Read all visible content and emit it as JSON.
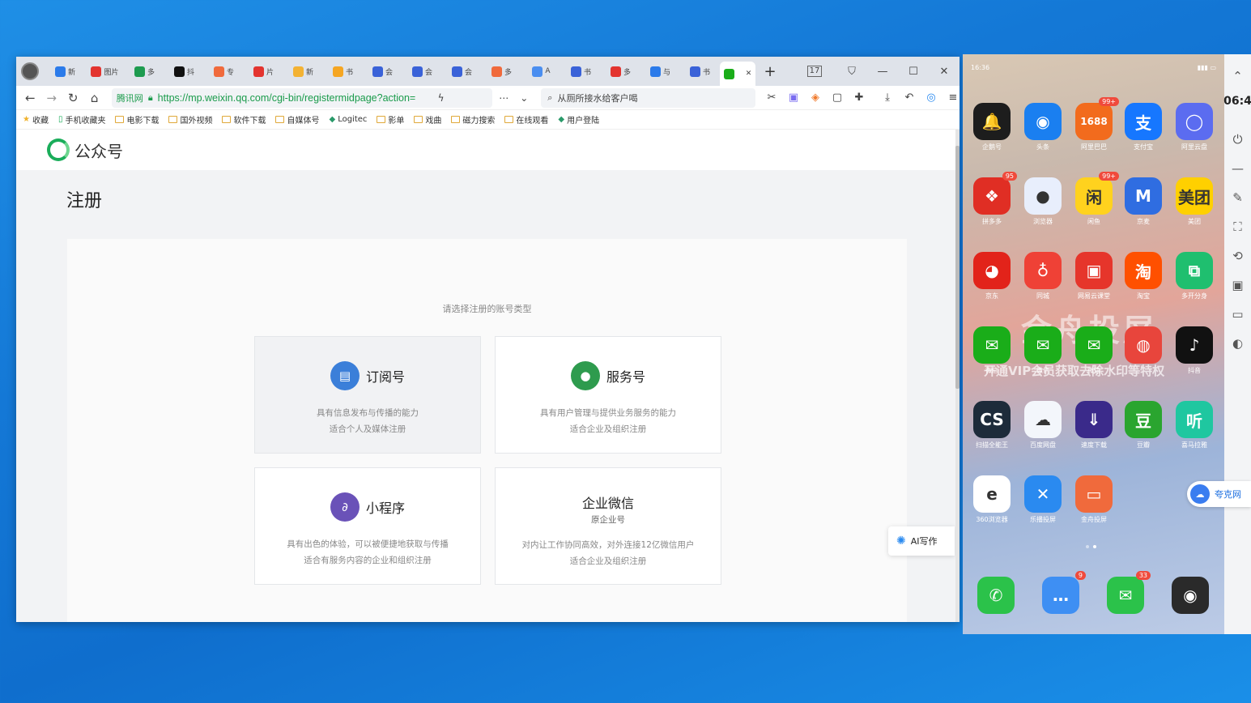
{
  "browser": {
    "tabs": [
      {
        "label": "新",
        "color": "#2b7bea"
      },
      {
        "label": "图片",
        "color": "#e3342f"
      },
      {
        "label": "多",
        "color": "#1d9b4f"
      },
      {
        "label": "抖",
        "color": "#111111"
      },
      {
        "label": "专",
        "color": "#f06a3c"
      },
      {
        "label": "片",
        "color": "#e3342f"
      },
      {
        "label": "新",
        "color": "#f3b233"
      },
      {
        "label": "书",
        "color": "#f5a623"
      },
      {
        "label": "会",
        "color": "#3a62d8"
      },
      {
        "label": "会",
        "color": "#3a62d8"
      },
      {
        "label": "会",
        "color": "#3a62d8"
      },
      {
        "label": "多",
        "color": "#f06a3c"
      },
      {
        "label": "A",
        "color": "#4a8ef0"
      },
      {
        "label": "书",
        "color": "#3a62d8"
      },
      {
        "label": "多",
        "color": "#e3342f"
      },
      {
        "label": "与",
        "color": "#2b7bea"
      },
      {
        "label": "书",
        "color": "#3a62d8"
      },
      {
        "label": "",
        "color": "#1aad19"
      }
    ],
    "new_tab": "+",
    "tab_count": "17",
    "window_controls": {
      "minimize": "—",
      "maximize": "☐",
      "close": "✕"
    },
    "address": {
      "site_badge": "腾讯网",
      "url": "https://mp.weixin.qq.com/cgi-bin/registermidpage?action=",
      "search_placeholder": "从厕所接水给客户喝"
    },
    "bookmarks": [
      {
        "label": "收藏",
        "type": "star"
      },
      {
        "label": "手机收藏夹",
        "type": "phone"
      },
      {
        "label": "电影下载",
        "type": "folder"
      },
      {
        "label": "国外视频",
        "type": "folder"
      },
      {
        "label": "软件下载",
        "type": "folder"
      },
      {
        "label": "自媒体号",
        "type": "folder"
      },
      {
        "label": "Logitec",
        "type": "site"
      },
      {
        "label": "影单",
        "type": "folder"
      },
      {
        "label": "戏曲",
        "type": "folder"
      },
      {
        "label": "磁力搜索",
        "type": "folder"
      },
      {
        "label": "在线观看",
        "type": "folder"
      },
      {
        "label": "用户登陆",
        "type": "site"
      }
    ]
  },
  "page": {
    "brand": "公众号",
    "title": "注册",
    "hint": "请选择注册的账号类型",
    "ai_button": "AI写作",
    "cards": [
      {
        "title": "订阅号",
        "sub": "",
        "line1": "具有信息发布与传播的能力",
        "line2": "适合个人及媒体注册",
        "color": "#3b7fd9",
        "icon": "▤"
      },
      {
        "title": "服务号",
        "sub": "",
        "line1": "具有用户管理与提供业务服务的能力",
        "line2": "适合企业及组织注册",
        "color": "#2e9b4e",
        "icon": "●"
      },
      {
        "title": "小程序",
        "sub": "",
        "line1": "具有出色的体验，可以被便捷地获取与传播",
        "line2": "适合有服务内容的企业和组织注册",
        "color": "#6a52b8",
        "icon": "∂"
      },
      {
        "title": "企业微信",
        "sub": "原企业号",
        "line1": "对内让工作协同高效，对外连接12亿微信用户",
        "line2": "适合企业及组织注册",
        "color": "",
        "icon": ""
      }
    ]
  },
  "phone": {
    "status_time": "16:36",
    "watermark": "金舟投屏",
    "watermark_sub": "开通VIP会员获取去除水印等特权",
    "apps": [
      {
        "label": "企鹅号",
        "color": "#1d1d1d",
        "glyph": "🔔",
        "badge": ""
      },
      {
        "label": "头条",
        "color": "#1a7ff0",
        "glyph": "◉",
        "badge": ""
      },
      {
        "label": "阿里巴巴",
        "color": "#f26b1d",
        "glyph": "1688",
        "badge": "99+"
      },
      {
        "label": "支付宝",
        "color": "#1677ff",
        "glyph": "支",
        "badge": ""
      },
      {
        "label": "阿里云盘",
        "color": "#5b6cf0",
        "glyph": "◯",
        "badge": ""
      },
      {
        "label": "拼多多",
        "color": "#e02e24",
        "glyph": "❖",
        "badge": "95"
      },
      {
        "label": "浏览器",
        "color": "#e8eefc",
        "glyph": "●",
        "badge": ""
      },
      {
        "label": "闲鱼",
        "color": "#ffd21e",
        "glyph": "闲",
        "badge": "99+"
      },
      {
        "label": "京麦",
        "color": "#2f6de1",
        "glyph": "M",
        "badge": ""
      },
      {
        "label": "美团",
        "color": "#ffd000",
        "glyph": "美团",
        "badge": ""
      },
      {
        "label": "京东",
        "color": "#e2231a",
        "glyph": "◕",
        "badge": ""
      },
      {
        "label": "同城",
        "color": "#ef4136",
        "glyph": "♁",
        "badge": ""
      },
      {
        "label": "网易云课堂",
        "color": "#e6352b",
        "glyph": "▣",
        "badge": ""
      },
      {
        "label": "淘宝",
        "color": "#ff5000",
        "glyph": "淘",
        "badge": ""
      },
      {
        "label": "多开分身",
        "color": "#1fbf6f",
        "glyph": "⧉",
        "badge": ""
      },
      {
        "label": "微信",
        "color": "#1aad19",
        "glyph": "✉",
        "badge": ""
      },
      {
        "label": "微信",
        "color": "#1aad19",
        "glyph": "✉",
        "badge": ""
      },
      {
        "label": "微信",
        "color": "#1aad19",
        "glyph": "✉",
        "badge": ""
      },
      {
        "label": "",
        "color": "#e8453c",
        "glyph": "◍",
        "badge": ""
      },
      {
        "label": "抖音",
        "color": "#111111",
        "glyph": "♪",
        "badge": ""
      },
      {
        "label": "扫描全能王",
        "color": "#1d2b3a",
        "glyph": "CS",
        "badge": ""
      },
      {
        "label": "百度网盘",
        "color": "#f3f6fb",
        "glyph": "☁",
        "badge": ""
      },
      {
        "label": "速度下载",
        "color": "#3a2a8a",
        "glyph": "⇓",
        "badge": ""
      },
      {
        "label": "豆瓣",
        "color": "#2aa52f",
        "glyph": "豆",
        "badge": ""
      },
      {
        "label": "喜马拉雅",
        "color": "#1fc7a0",
        "glyph": "听",
        "badge": ""
      },
      {
        "label": "360浏览器",
        "color": "#ffffff",
        "glyph": "e",
        "badge": ""
      },
      {
        "label": "乐播投屏",
        "color": "#2a8af0",
        "glyph": "✕",
        "badge": ""
      },
      {
        "label": "金舟投屏",
        "color": "#f06a3c",
        "glyph": "▭",
        "badge": ""
      }
    ],
    "dock": [
      {
        "label": "",
        "color": "#2bc24a",
        "glyph": "✆",
        "badge": ""
      },
      {
        "label": "",
        "color": "#3e8ff3",
        "glyph": "…",
        "badge": "9"
      },
      {
        "label": "",
        "color": "#2bc24a",
        "glyph": "✉",
        "badge": "33"
      },
      {
        "label": "",
        "color": "#2a2a2a",
        "glyph": "◉",
        "badge": ""
      }
    ]
  },
  "side_panel": {
    "time": "06:4",
    "quark_label": "夸克网"
  }
}
